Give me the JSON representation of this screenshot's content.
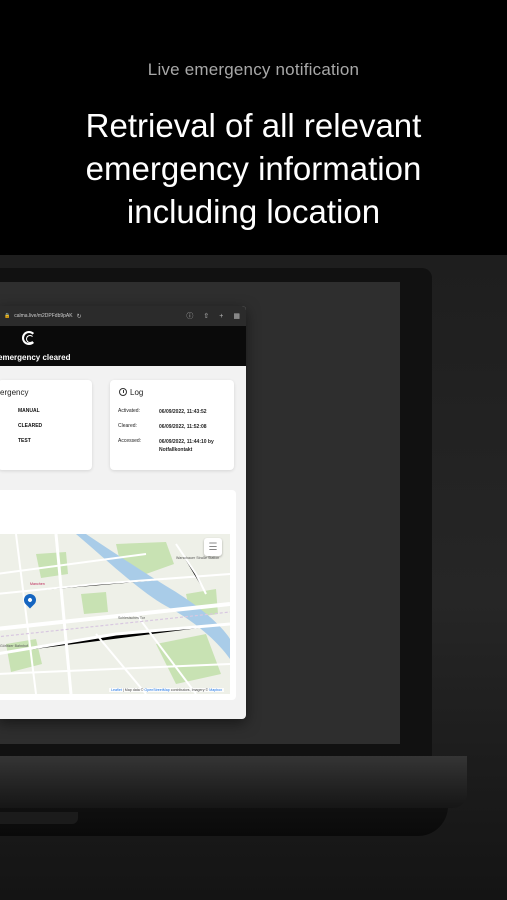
{
  "header": {
    "subtitle": "Live emergency notification",
    "headline_line1": "Retrieval of all relevant",
    "headline_line2": "emergency information",
    "headline_line3": "including location"
  },
  "browser": {
    "url": "calma.live/m2DPFdb9pAK",
    "lock_icon": "lock-icon",
    "reload_icon": "reload-icon",
    "toolbar_icons": [
      "info-icon",
      "share-icon",
      "plus-icon",
      "tabs-icon"
    ]
  },
  "app": {
    "logo_icon": "calma-logo",
    "status": "emergency cleared"
  },
  "emergency_card": {
    "title": "ergency",
    "rows": [
      "MANUAL",
      "CLEARED",
      "TEST"
    ]
  },
  "log_card": {
    "title": "Log",
    "activated_label": "Activated:",
    "activated_value": "06/09/2022, 11:43:52",
    "cleared_label": "Cleared:",
    "cleared_value": "06/09/2022, 11:52:08",
    "accessed_label": "Accessed:",
    "accessed_value_line1": "06/09/2022, 11:44:10 by",
    "accessed_value_line2": "Notfallkontakt"
  },
  "map": {
    "attribution_leaflet": "Leaflet",
    "attribution_text": " | Map data © ",
    "attribution_osm": "OpenStreetMap",
    "attribution_text2": " contributors, Imagery © ",
    "attribution_mapbox": "Mapbox",
    "labels": {
      "warschau": "Warschauer Straße Station",
      "schlesisches": "Schlesisches Tor",
      "goerlitzer": "Görlitzer Bahnhof",
      "manchen": "Manchen"
    },
    "colors": {
      "water": "#a9cce8",
      "park": "#c8e2b3",
      "road": "#ffffff",
      "base": "#eef0e8"
    }
  }
}
